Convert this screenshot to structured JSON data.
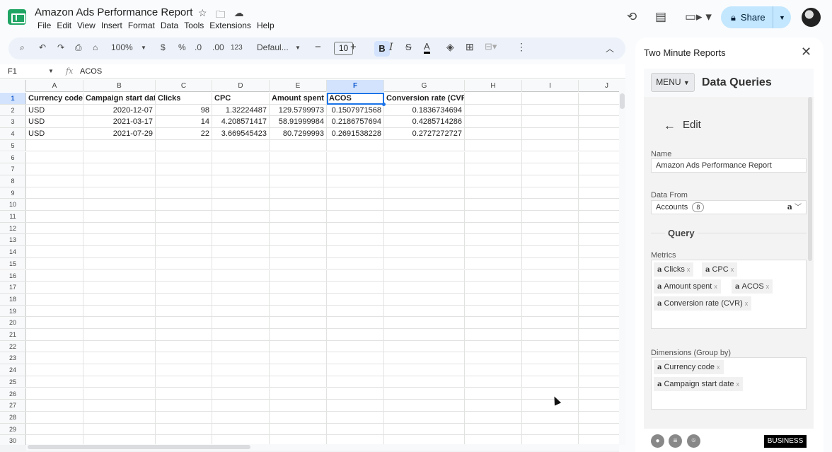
{
  "document": {
    "title": "Amazon Ads Performance Report",
    "menu": [
      "File",
      "Edit",
      "View",
      "Insert",
      "Format",
      "Data",
      "Tools",
      "Extensions",
      "Help"
    ],
    "share_label": "Share"
  },
  "toolbar": {
    "zoom": "100%",
    "currency": "$",
    "percent": "%",
    "dec_decrease": ".0",
    "dec_increase": ".00",
    "number_format": "123",
    "font": "Defaul...",
    "font_size": "10",
    "bold": "B",
    "italic": "I",
    "text_color": "A"
  },
  "formula_bar": {
    "cell_ref": "F1",
    "fx": "fx",
    "value": "ACOS"
  },
  "sheet": {
    "columns": [
      "A",
      "B",
      "C",
      "D",
      "E",
      "F",
      "G",
      "H",
      "I",
      "J"
    ],
    "selected_column": "F",
    "row_numbers": [
      "1",
      "2",
      "3",
      "4",
      "5",
      "6",
      "7",
      "8",
      "9",
      "10",
      "11",
      "12",
      "13",
      "14",
      "15",
      "16",
      "17",
      "18",
      "19",
      "20",
      "21",
      "22",
      "23",
      "24",
      "25",
      "26",
      "27",
      "28",
      "29",
      "30"
    ],
    "header": [
      "Currency code",
      "Campaign start date",
      "Clicks",
      "CPC",
      "Amount spent",
      "ACOS",
      "Conversion rate (CVR)"
    ],
    "rows": [
      [
        "USD",
        "2020-12-07",
        "98",
        "1.32224487",
        "129.5799973",
        "0.1507971568",
        "0.1836734694"
      ],
      [
        "USD",
        "2021-03-17",
        "14",
        "4.208571417",
        "58.91999984",
        "0.2186757694",
        "0.4285714286"
      ],
      [
        "USD",
        "2021-07-29",
        "22",
        "3.669545423",
        "80.7299993",
        "0.2691538228",
        "0.2727272727"
      ]
    ]
  },
  "panel": {
    "title": "Two Minute Reports",
    "menu_label": "MENU",
    "section": "Data Queries",
    "edit_label": "Edit",
    "name_label": "Name",
    "name_value": "Amazon Ads Performance Report",
    "data_from_label": "Data From",
    "accounts_label": "Accounts",
    "accounts_count": "8",
    "query_label": "Query",
    "metrics_label": "Metrics",
    "metrics": [
      "Clicks",
      "CPC",
      "Amount spent",
      "ACOS",
      "Conversion rate (CVR)"
    ],
    "dimensions_label": "Dimensions (Group by)",
    "dimensions": [
      "Currency code",
      "Campaign start date"
    ],
    "amazon_glyph": "a",
    "remove_glyph": "x",
    "plan_badge": "BUSINESS"
  }
}
